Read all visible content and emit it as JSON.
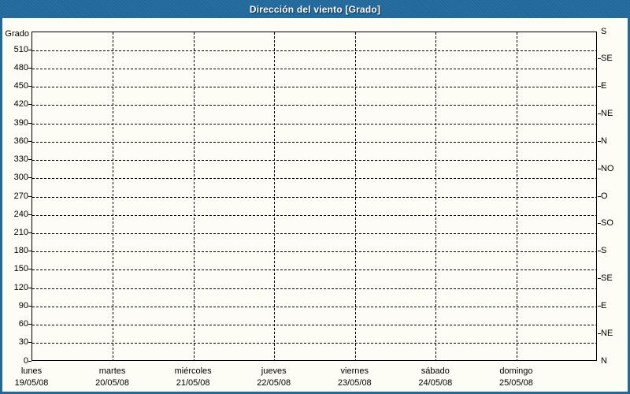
{
  "window": {
    "title": "Dirección del viento [Grado]",
    "colors": {
      "title_bar_bg": "#21689B",
      "title_text": "#FFFFFF",
      "frame_border": "#21689B",
      "page_bg": "#FDFDF5",
      "plot_border": "#000000",
      "grid_line": "#000000",
      "label_text": "#000000"
    }
  },
  "chart_data": {
    "type": "line",
    "title": "Dirección del viento [Grado]",
    "ylabel": "Grado",
    "ylim": [
      0,
      540
    ],
    "y_tick_step": 30,
    "y_tick_labels": [
      0,
      30,
      60,
      90,
      120,
      150,
      180,
      210,
      240,
      270,
      300,
      330,
      360,
      390,
      420,
      450,
      480,
      510
    ],
    "right_axis_ticks": [
      {
        "deg": 540,
        "label": "S"
      },
      {
        "deg": 495,
        "label": "SE"
      },
      {
        "deg": 450,
        "label": "E"
      },
      {
        "deg": 405,
        "label": "NE"
      },
      {
        "deg": 360,
        "label": "N"
      },
      {
        "deg": 315,
        "label": "NO"
      },
      {
        "deg": 270,
        "label": "O"
      },
      {
        "deg": 225,
        "label": "SO"
      },
      {
        "deg": 180,
        "label": "S"
      },
      {
        "deg": 135,
        "label": "SE"
      },
      {
        "deg": 90,
        "label": "E"
      },
      {
        "deg": 45,
        "label": "NE"
      },
      {
        "deg": 0,
        "label": "N"
      }
    ],
    "x_categories": [
      {
        "day": "lunes",
        "date": "19/05/08"
      },
      {
        "day": "martes",
        "date": "20/05/08"
      },
      {
        "day": "miércoles",
        "date": "21/05/08"
      },
      {
        "day": "jueves",
        "date": "22/05/08"
      },
      {
        "day": "viernes",
        "date": "23/05/08"
      },
      {
        "day": "sábado",
        "date": "24/05/08"
      },
      {
        "day": "domingo",
        "date": "25/05/08"
      }
    ],
    "series": [],
    "grid": {
      "horizontal": "on",
      "vertical": "on",
      "style": "dashed"
    },
    "legend": "none"
  }
}
